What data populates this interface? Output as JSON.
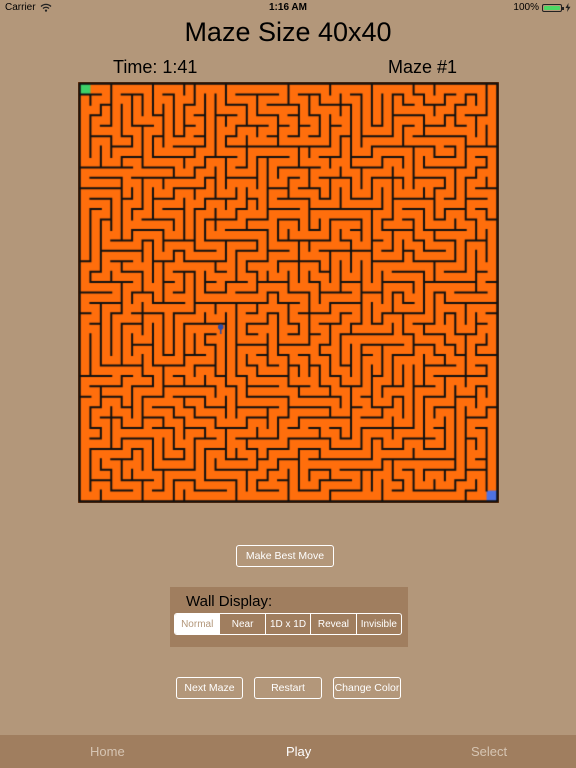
{
  "status_bar": {
    "carrier": "Carrier",
    "time": "1:16 AM",
    "battery": "100%"
  },
  "header": {
    "title": "Maze Size 40x40",
    "time": "Time: 1:41",
    "maze_number": "Maze #1"
  },
  "maze": {
    "size": 40,
    "background_color": "#ff6e0c",
    "wall_color": "#111111",
    "start_color": "#3dd169",
    "end_color": "#4f72e3",
    "player_color": "#2e4ea8"
  },
  "buttons": {
    "best_move": "Make Best Move",
    "next_maze": "Next Maze",
    "restart": "Restart",
    "change_color": "Change Color"
  },
  "wall_display": {
    "label": "Wall Display:",
    "options": [
      "Normal",
      "Near",
      "1D x 1D",
      "Reveal",
      "Invisible"
    ],
    "selected": "Normal"
  },
  "tabs": {
    "home": "Home",
    "play": "Play",
    "select": "Select",
    "active": "Play"
  }
}
